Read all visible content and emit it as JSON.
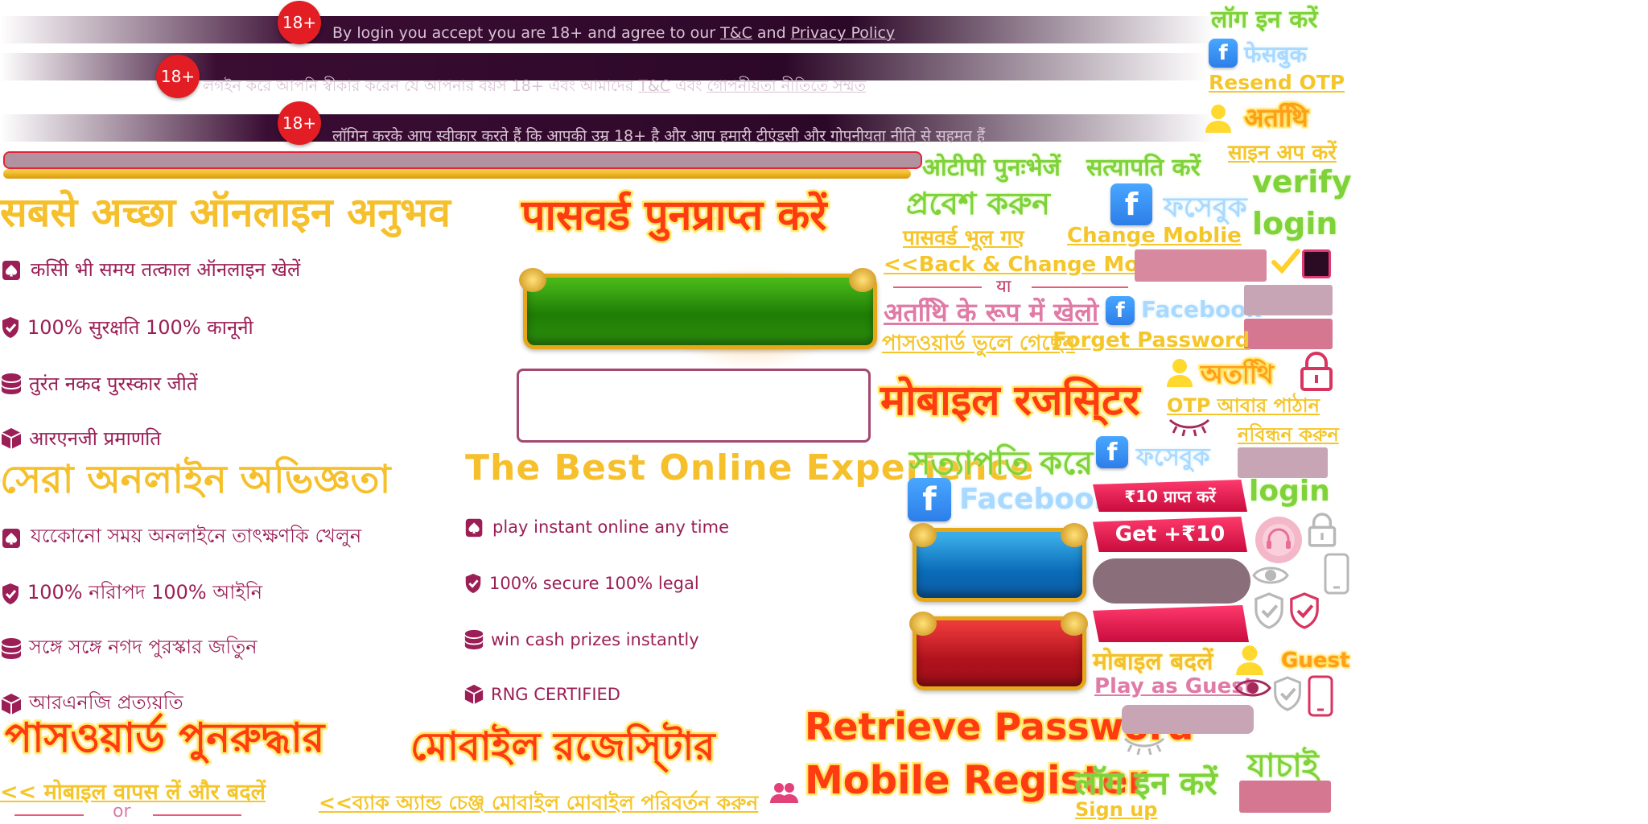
{
  "age_badge": "18+",
  "consent_strips": [
    {
      "prefix": "By login you accept you are 18+ and agree to our ",
      "tc": "T&C",
      "mid": " and ",
      "privacy": "Privacy Policy",
      "suffix": ""
    },
    {
      "prefix": "লগইন করে আপনি স্বীকার করেন যে আপনার বয়স 18+ এবং আমাদের ",
      "tc": "T&C",
      "mid": " এবং ",
      "privacy": "গোপনীয়তা নীতিতে সম্মত",
      "suffix": ""
    },
    {
      "prefix": "लॉगिन करके आप स्वीकार करते हैं कि आपकी उम्र 18+ है और आप हमारी ",
      "tc": "टीएंडसी",
      "mid": " और ",
      "privacy": "गोपनीयता नीति",
      "suffix": " से सहमत हैं"
    }
  ],
  "headings": {
    "hi_best_experience": "सबसे अच्छा ऑनलाइन अनुभव",
    "bn_best_experience": "সেরা অনলাইন অভিজ্ঞতা",
    "en_best_experience": "The Best Online Experience"
  },
  "features_hi": [
    "कसिी भी समय तत्काल ऑनलाइन खेलें",
    "100% सुरक्षति 100% कानूनी",
    "तुरंत नकद पुरस्कार जीतें",
    "आरएनजी प्रमाणति"
  ],
  "features_bn": [
    "যকোেনো সময় অনলাইনে তাৎক্ষণকি খেলুন",
    "100% নরিাপদ 100% আইনি",
    "সঙ্গে সঙ্গে নগদ পুরস্কার জতিুন",
    "আরএনজি প্রত্যয়তি"
  ],
  "features_en": [
    "play  instant  online any time",
    "100% secure  100% legal",
    "win cash  prizes  instantly",
    "RNG   CERTIFIED"
  ],
  "stickers": {
    "hi_retrieve_password": "पासवर्ड पुनप्राप्त करें",
    "hi_mobile_register": "मोबाइल रजसि्टर",
    "bn_retrieve_password": "পাসওয়ার্ড পুনরুদ্ধার",
    "bn_mobile_register": "মোবাইল রজেসি্টার",
    "en_retrieve_password": "Retrieve Password",
    "en_mobile_register": "Mobile Register"
  },
  "green_labels": {
    "login_hi": "लॉग इन करें",
    "resend_otp_hi": "ओटीपी पुनःभेजें",
    "verify_hi": "सत्यापति करें",
    "signin_bn": "প্রবেশ করুন",
    "verify_en": "verify",
    "login_en": "login",
    "verify_bn": "সত্যাপতি করে",
    "login_en_2": "login",
    "login_hi_2": "लॉग इन करें",
    "verify_bn_2": "যাচাই"
  },
  "links": {
    "resend_otp_en": "Resend OTP",
    "signup_hi": "साइन अप करें",
    "forgot_password_hi": "पासवर्ड भूल गए",
    "change_mobile_en": "Change Moblie",
    "back_change_mobile_en": "<<Back & Change Mobile",
    "forgot_password_bn": "পাসওয়ার্ড ভুলে গেছেন",
    "forget_password_en": "Forget Password",
    "resend_otp_bn": "OTP আবার পাঠান",
    "register_bn": "নবিন্ধন করুন",
    "change_mobile_hi": "मोबाइल बदलें",
    "play_as_guest_en": "Play as Guest",
    "back_change_mobile_hi": "<< मोबाइल वापस लें और बदलें",
    "back_change_mobile_bn": "<<ব্যাক অ্যান্ড চেঞ্জ মোবাইল মোবাইল পরিবর্তন করুন",
    "signup_en": "Sign up"
  },
  "divider_or_hi": "या",
  "divider_or_en": "or",
  "guest": {
    "hi": "अतथिि",
    "bn": "অতথিি",
    "en": "Guest",
    "play_as_guest_hi": "अतथिि के रूप में खेलो"
  },
  "facebook": {
    "icon": "f",
    "hi": "फेसबुक",
    "bn": "ফসেবুক",
    "en": "Facebook"
  },
  "rewards": {
    "hi": "₹10 प्राप्त करें",
    "en": "Get +₹10"
  },
  "colors": {
    "accent_yellow": "#f6c02c",
    "feature_text": "#9b1f56",
    "sticker_red": "#ff3b12",
    "green_label": "#7fd23a",
    "ribbon_red": "#e0164a",
    "badge_red": "#e21d23"
  },
  "icons": [
    "checkmark-icon",
    "lock-icon",
    "eye-icon",
    "eye-closed-icon",
    "shield-check-icon",
    "phone-icon",
    "guest-user-icon",
    "users-icon",
    "headset-icon",
    "spade-card-icon",
    "coins-icon",
    "cube-icon"
  ]
}
